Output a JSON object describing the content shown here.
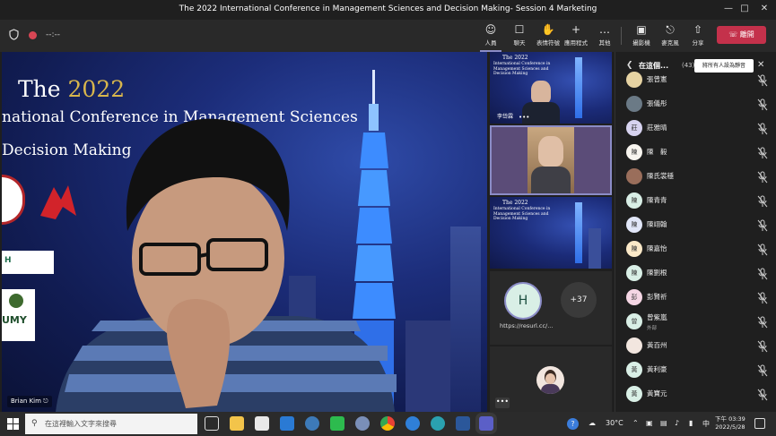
{
  "window": {
    "title": "The 2022 International Conference in Management Sciences and Decision Making- Session 4 Marketing",
    "minimize_icon": "minimize-icon",
    "maximize_icon": "maximize-icon",
    "close_icon": "close-icon"
  },
  "toolbar": {
    "timer": "--:--",
    "buttons": [
      {
        "icon": "people-icon",
        "label": "人員"
      },
      {
        "icon": "chat-icon",
        "label": "聊天"
      },
      {
        "icon": "raise-hand-icon",
        "label": "表情符號"
      },
      {
        "icon": "apps-icon",
        "label": "應用程式"
      },
      {
        "icon": "more-icon",
        "label": "其他"
      },
      {
        "icon": "camera-icon",
        "label": "攝影機"
      },
      {
        "icon": "mic-icon",
        "label": "麥克風"
      },
      {
        "icon": "share-icon",
        "label": "分享"
      }
    ],
    "leave_label": "離開",
    "colors": {
      "leave": "#c4314b",
      "active_underline": "#8b8cc7"
    }
  },
  "main_video": {
    "slide_line1_prefix": "The ",
    "slide_year": "2022",
    "slide_line2": "national Conference in Management Sciences",
    "slide_line3": "Decision Making",
    "logo_h": "H",
    "logo_umy": "UMY",
    "speaker_name": "Brian Kim"
  },
  "thumbnails": [
    {
      "title1": "The 2022",
      "title2": "International Conference in Management Sciences and Decision Making",
      "name": "李岱霖",
      "more": "•••"
    },
    {
      "name": ""
    },
    {
      "title1": "The 2022",
      "title2": "International Conference in Management Sciences and Decision Making"
    }
  ],
  "gallery": {
    "avatar_initial": "H",
    "url_label": "https://resurl.cc/...",
    "overflow_count": "+37",
    "more_dots": "•••"
  },
  "participants_panel": {
    "title": "在這個...",
    "count": "(43)",
    "mute_all": "將所有人設為靜音",
    "participants": [
      {
        "initial": "",
        "name": "張曾憲",
        "sub": "",
        "color": "#e6d3a3"
      },
      {
        "initial": "",
        "name": "張儀彤",
        "sub": "",
        "color": "#6b7a86"
      },
      {
        "initial": "莊",
        "name": "莊雅晴",
        "sub": "",
        "color": "#d7d3f0"
      },
      {
        "initial": "陳",
        "name": "陳　毅",
        "sub": "",
        "color": "#f8f5ef"
      },
      {
        "initial": "",
        "name": "陳氏裳穩",
        "sub": "",
        "color": "#9a6e5b"
      },
      {
        "initial": "陳",
        "name": "陳青青",
        "sub": "",
        "color": "#d9efe6"
      },
      {
        "initial": "陳",
        "name": "陳翊翰",
        "sub": "",
        "color": "#e1e6f8"
      },
      {
        "initial": "陳",
        "name": "陳嘉怡",
        "sub": "",
        "color": "#fbe9c8"
      },
      {
        "initial": "陳",
        "name": "陳劉根",
        "sub": "",
        "color": "#d9efe6"
      },
      {
        "initial": "彭",
        "name": "彭賢祈",
        "sub": "",
        "color": "#f5d6e4"
      },
      {
        "initial": "曾",
        "name": "曾紫嵐",
        "sub": "外部",
        "color": "#d9efe6"
      },
      {
        "initial": "",
        "name": "黃百州",
        "sub": "",
        "color": "#f2e6df"
      },
      {
        "initial": "黃",
        "name": "黃利豪",
        "sub": "",
        "color": "#d9efe6"
      },
      {
        "initial": "黃",
        "name": "黃寶元",
        "sub": "",
        "color": "#d9efe6"
      }
    ]
  },
  "taskbar": {
    "search_placeholder": "在這裡輸入文字來搜尋",
    "weather": "30°C",
    "ime": "中",
    "time": "下午 03:39",
    "date": "2022/5/28"
  }
}
